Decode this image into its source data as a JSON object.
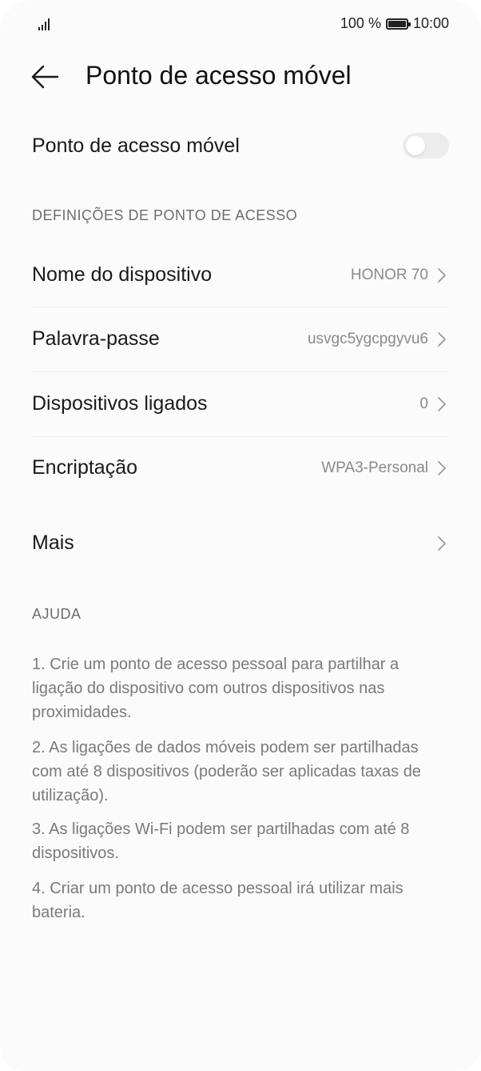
{
  "status_bar": {
    "battery_text": "100 %",
    "time": "10:00"
  },
  "header": {
    "title": "Ponto de acesso móvel"
  },
  "hotspot_toggle": {
    "label": "Ponto de acesso móvel",
    "enabled": false
  },
  "settings_section": {
    "title": "DEFINIÇÕES DE PONTO DE ACESSO",
    "items": [
      {
        "label": "Nome do dispositivo",
        "value": "HONOR 70"
      },
      {
        "label": "Palavra-passe",
        "value": "usvgc5ygcpgyvu6"
      },
      {
        "label": "Dispositivos ligados",
        "value": "0"
      },
      {
        "label": "Encriptação",
        "value": "WPA3-Personal"
      }
    ]
  },
  "more": {
    "label": "Mais"
  },
  "help": {
    "title": "AJUDA",
    "items": [
      "1. Crie um ponto de acesso pessoal para partilhar a ligação do dispositivo com outros dispositivos nas proximidades.",
      "2. As ligações de dados móveis podem ser partilhadas com até 8 dispositivos (poderão ser aplicadas taxas de utilização).",
      "3. As ligações Wi-Fi podem ser partilhadas com até 8 dispositivos.",
      "4. Criar um ponto de acesso pessoal irá utilizar mais bateria."
    ]
  },
  "icons": {
    "back": "arrow-left-icon",
    "chevron": "chevron-right-icon",
    "signal": "signal-icon",
    "battery": "battery-icon"
  }
}
